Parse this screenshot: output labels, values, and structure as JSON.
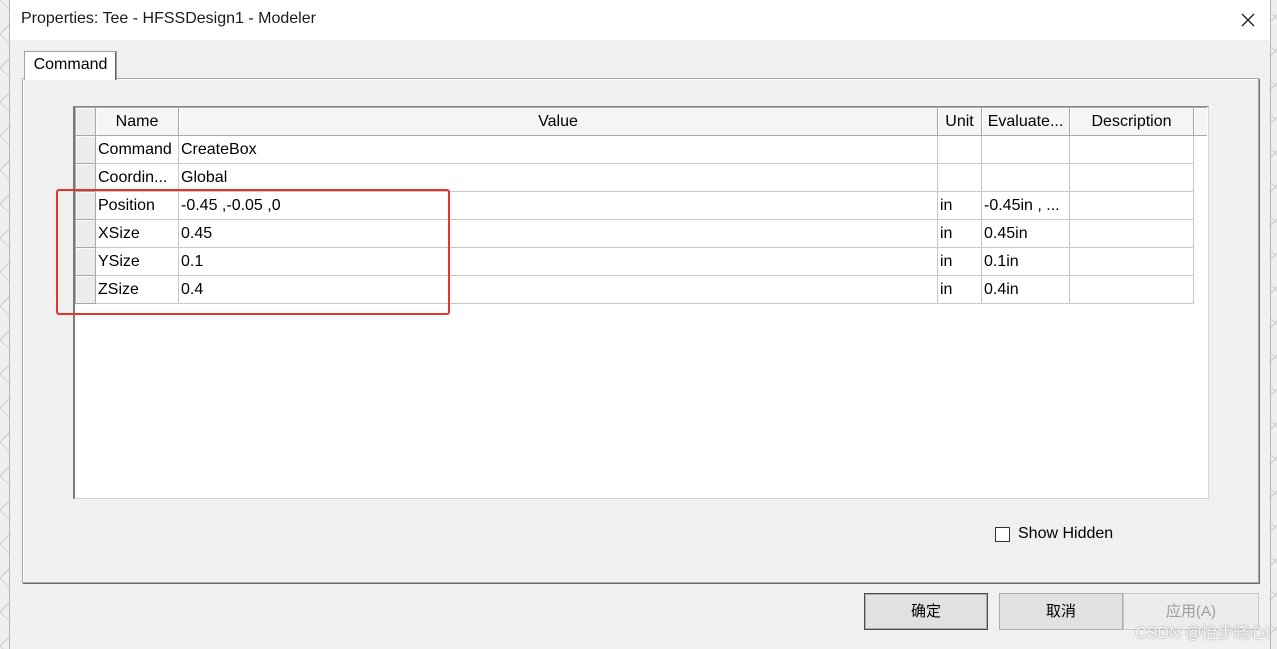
{
  "window": {
    "title": "Properties: Tee - HFSSDesign1 - Modeler"
  },
  "tabs": [
    {
      "label": "Command",
      "active": true
    }
  ],
  "grid": {
    "columns": [
      "Name",
      "Value",
      "Unit",
      "Evaluate...",
      "Description"
    ],
    "rows": [
      {
        "name": "Command",
        "value": "CreateBox",
        "unit": "",
        "evaluated": "",
        "description": ""
      },
      {
        "name": "Coordin...",
        "value": "Global",
        "unit": "",
        "evaluated": "",
        "description": ""
      },
      {
        "name": "Position",
        "value": "-0.45 ,-0.05 ,0",
        "unit": "in",
        "evaluated": "-0.45in , ...",
        "description": ""
      },
      {
        "name": "XSize",
        "value": "0.45",
        "unit": "in",
        "evaluated": "0.45in",
        "description": ""
      },
      {
        "name": "YSize",
        "value": "0.1",
        "unit": "in",
        "evaluated": "0.1in",
        "description": ""
      },
      {
        "name": "ZSize",
        "value": "0.4",
        "unit": "in",
        "evaluated": "0.4in",
        "description": ""
      }
    ]
  },
  "show_hidden": {
    "label": "Show Hidden",
    "checked": false
  },
  "buttons": {
    "ok": "确定",
    "cancel": "取消",
    "apply": "应用(A)"
  },
  "watermark": "CSDN @怡步晓心l",
  "colors": {
    "highlight": "#e8332b",
    "dialog_bg": "#f0f0f0",
    "button_bg": "#e1e1e1"
  }
}
